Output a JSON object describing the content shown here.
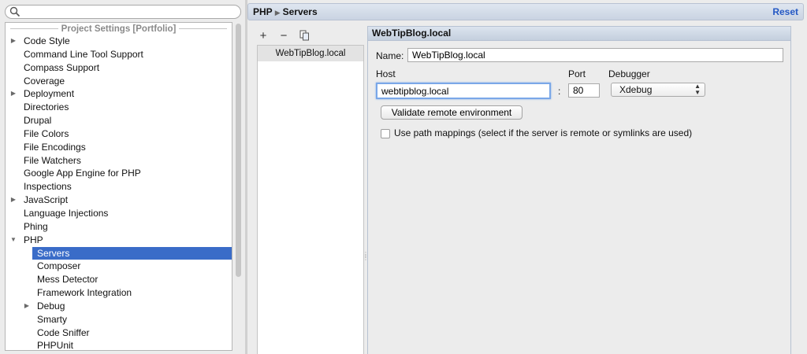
{
  "search": {
    "placeholder": "",
    "value": ""
  },
  "tree": {
    "header": "Project Settings [Portfolio]",
    "items": [
      {
        "label": "Code Style",
        "expandable": true,
        "level": 0
      },
      {
        "label": "Command Line Tool Support",
        "expandable": false,
        "level": 0
      },
      {
        "label": "Compass Support",
        "expandable": false,
        "level": 0
      },
      {
        "label": "Coverage",
        "expandable": false,
        "level": 0
      },
      {
        "label": "Deployment",
        "expandable": true,
        "level": 0
      },
      {
        "label": "Directories",
        "expandable": false,
        "level": 0
      },
      {
        "label": "Drupal",
        "expandable": false,
        "level": 0
      },
      {
        "label": "File Colors",
        "expandable": false,
        "level": 0
      },
      {
        "label": "File Encodings",
        "expandable": false,
        "level": 0
      },
      {
        "label": "File Watchers",
        "expandable": false,
        "level": 0
      },
      {
        "label": "Google App Engine for PHP",
        "expandable": false,
        "level": 0
      },
      {
        "label": "Inspections",
        "expandable": false,
        "level": 0
      },
      {
        "label": "JavaScript",
        "expandable": true,
        "level": 0
      },
      {
        "label": "Language Injections",
        "expandable": false,
        "level": 0
      },
      {
        "label": "Phing",
        "expandable": false,
        "level": 0
      },
      {
        "label": "PHP",
        "expandable": true,
        "expanded": true,
        "level": 0
      },
      {
        "label": "Servers",
        "expandable": false,
        "level": 1,
        "selected": true
      },
      {
        "label": "Composer",
        "expandable": false,
        "level": 1
      },
      {
        "label": "Mess Detector",
        "expandable": false,
        "level": 1
      },
      {
        "label": "Framework Integration",
        "expandable": false,
        "level": 1
      },
      {
        "label": "Debug",
        "expandable": true,
        "level": 1
      },
      {
        "label": "Smarty",
        "expandable": false,
        "level": 1
      },
      {
        "label": "Code Sniffer",
        "expandable": false,
        "level": 1
      },
      {
        "label": "PHPUnit",
        "expandable": false,
        "level": 1
      }
    ]
  },
  "breadcrumb": {
    "parent": "PHP",
    "current": "Servers",
    "separator": "▶"
  },
  "reset_label": "Reset",
  "toolbar": {
    "add": "+",
    "remove": "−",
    "copy": "copy-icon"
  },
  "servers": {
    "items": [
      "WebTipBlog.local"
    ]
  },
  "detail": {
    "title": "WebTipBlog.local",
    "name_label": "Name:",
    "name_value": "WebTipBlog.local",
    "host_label": "Host",
    "host_value": "webtipblog.local",
    "colon": ":",
    "port_label": "Port",
    "port_value": "80",
    "debugger_label": "Debugger",
    "debugger_value": "Xdebug",
    "validate_label": "Validate remote environment",
    "path_mappings_label": "Use path mappings (select if the server is remote or symlinks are used)",
    "path_mappings_checked": false
  },
  "colors": {
    "selection": "#3a6cc8",
    "link": "#2458c4",
    "focus": "#7aa7e8"
  }
}
